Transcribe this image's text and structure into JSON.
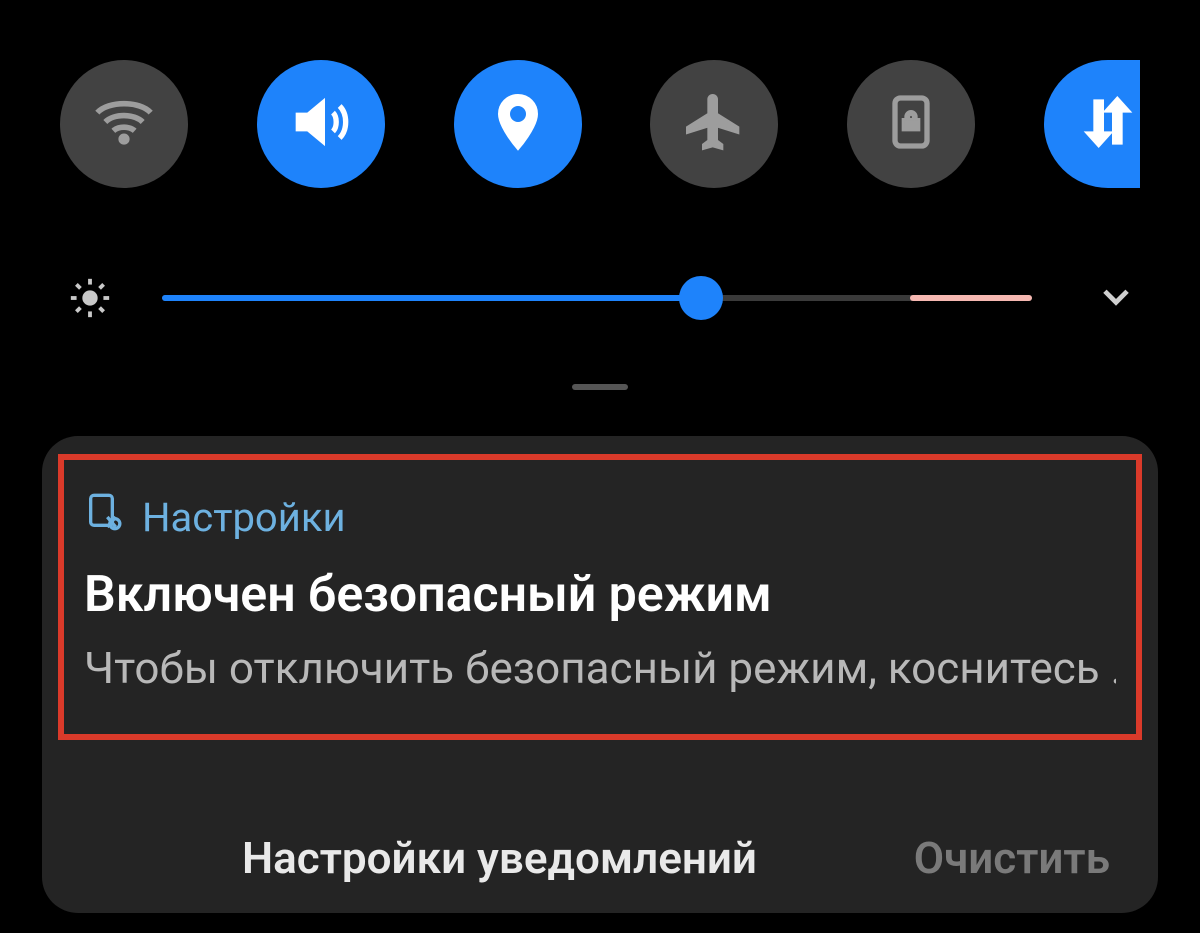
{
  "toggles": [
    {
      "name": "wifi-toggle",
      "state": "off",
      "icon": "wifi"
    },
    {
      "name": "sound-toggle",
      "state": "on",
      "icon": "sound"
    },
    {
      "name": "location-toggle",
      "state": "on",
      "icon": "location"
    },
    {
      "name": "airplane-toggle",
      "state": "off",
      "icon": "airplane"
    },
    {
      "name": "rotation-lock-toggle",
      "state": "off",
      "icon": "rotation-lock"
    },
    {
      "name": "mobile-data-toggle",
      "state": "on",
      "icon": "mobile-data"
    }
  ],
  "brightness": {
    "value": 62,
    "warn_start": 86,
    "warn_end": 100
  },
  "notification": {
    "app_name": "Настройки",
    "title": "Включен безопасный режим",
    "body": "Чтобы отключить безопасный режим, коснитесь .."
  },
  "footer": {
    "settings_label": "Настройки уведомлений",
    "clear_label": "Очистить"
  },
  "colors": {
    "accent": "#1e83fb",
    "toggle_off": "#424242",
    "highlight_border": "#da3a2a"
  }
}
